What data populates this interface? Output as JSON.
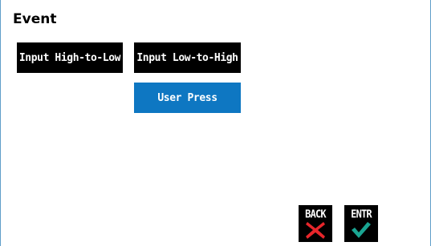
{
  "screen": {
    "title": "Event"
  },
  "options": {
    "high_to_low": "Input High-to-Low",
    "low_to_high": "Input Low-to-High",
    "user_press": "User Press",
    "selected": "User Press"
  },
  "nav": {
    "back_label": "BACK",
    "enter_label": "ENTR",
    "back_icon": "x-icon",
    "enter_icon": "check-icon"
  },
  "colors": {
    "selected_button": "#0e77c2",
    "unselected_button": "#000000",
    "back_icon": "#e8262b",
    "enter_icon": "#1aa592",
    "frame_border": "#5f9ec9"
  }
}
